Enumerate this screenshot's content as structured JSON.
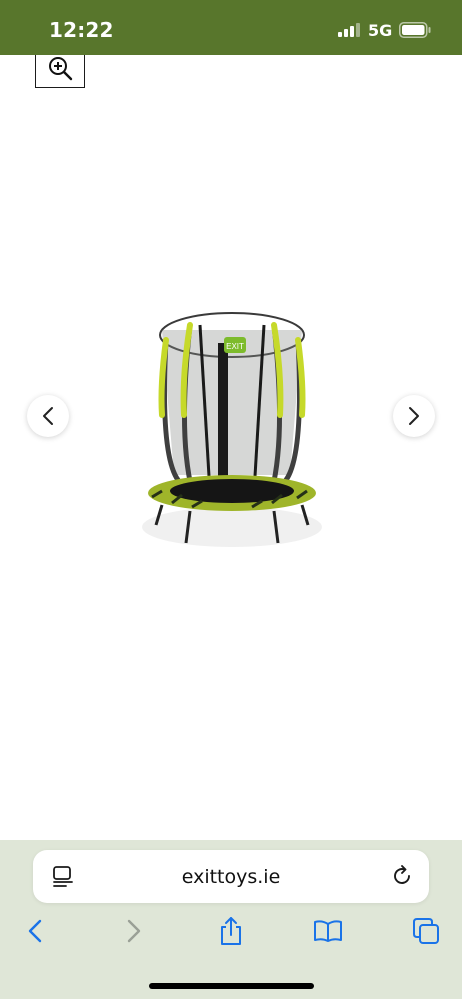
{
  "status_bar": {
    "time": "12:22",
    "network": "5G",
    "color": "#58762c",
    "icons": [
      "signal-icon",
      "battery-icon"
    ]
  },
  "product_gallery": {
    "zoom_icon": "zoom-in-icon",
    "image_alt": "Trampoline with safety net",
    "prev_icon": "chevron-left-icon",
    "next_icon": "chevron-right-icon",
    "logo_text": "EXIT"
  },
  "browser": {
    "url": "exittoys.ie",
    "reader_icon": "reader-mode-icon",
    "reload_icon": "reload-icon",
    "toolbar": [
      "back-icon",
      "forward-icon",
      "share-icon",
      "bookmarks-icon",
      "tabs-icon"
    ],
    "accent": "#1a73e8",
    "background": "#dfe6d7"
  }
}
